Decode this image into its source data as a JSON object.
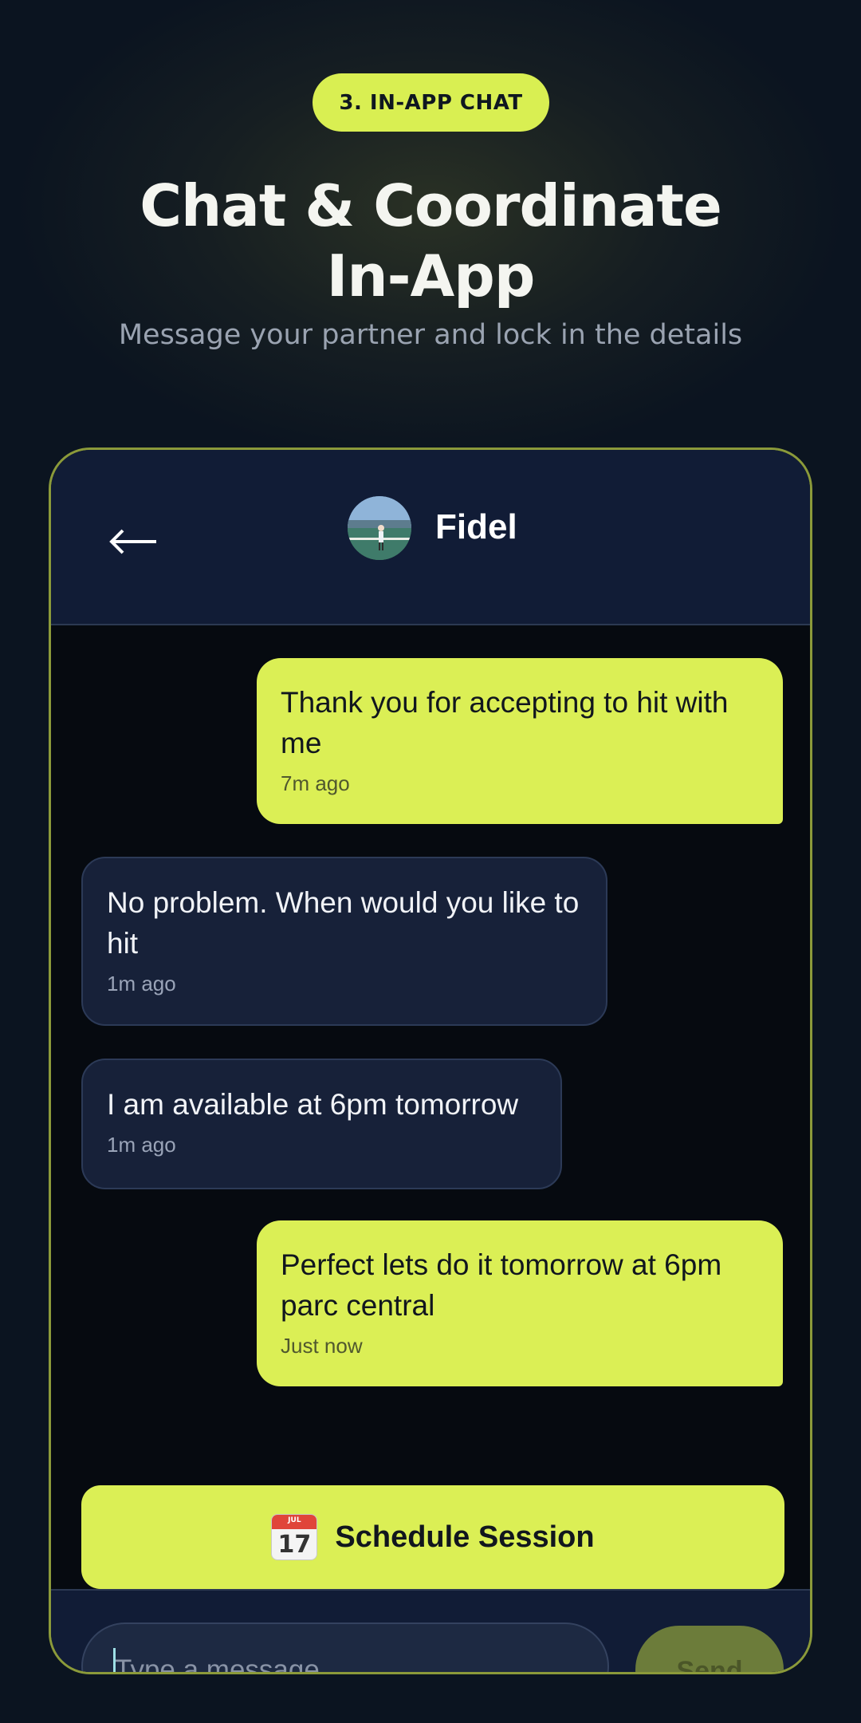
{
  "banner": {
    "pill": "3. IN-APP CHAT",
    "headline_line1": "Chat & Coordinate",
    "headline_line2": "In-App",
    "subtitle": "Message your partner and lock in the details"
  },
  "chat": {
    "back_icon": "back-arrow-icon",
    "contact_name": "Fidel",
    "messages": [
      {
        "direction": "outgoing",
        "text": "Thank you for accepting to hit with me",
        "time": "7m ago"
      },
      {
        "direction": "incoming",
        "text": "No problem. When would you like to hit",
        "time": "1m ago"
      },
      {
        "direction": "incoming",
        "text": "I am available at 6pm tomorrow",
        "time": "1m ago"
      },
      {
        "direction": "outgoing",
        "text": "Perfect lets do it tomorrow at 6pm parc central",
        "time": "Just now"
      }
    ],
    "schedule_button": {
      "icon": "calendar-icon",
      "icon_month": "JUL",
      "icon_day": "17",
      "label": "Schedule Session"
    },
    "composer": {
      "placeholder": "Type a message",
      "send_label": "Send"
    }
  },
  "colors": {
    "accent": "#dbef55",
    "background": "#0b1420",
    "header": "#111c36",
    "incoming_bubble": "#172139"
  }
}
